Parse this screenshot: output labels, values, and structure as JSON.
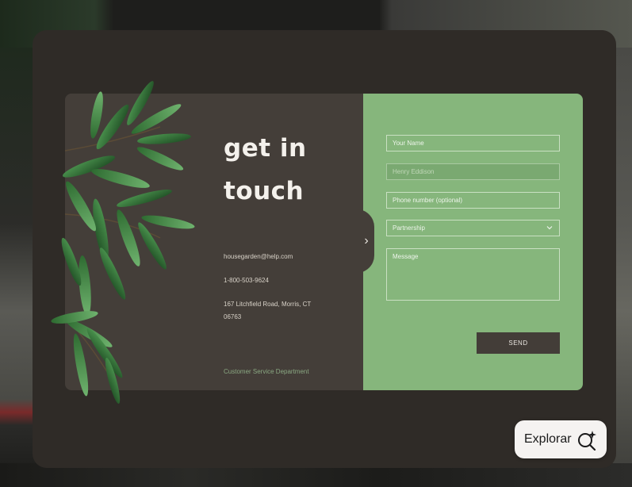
{
  "contact": {
    "title_line1": "get in",
    "title_line2": "touch",
    "email": "housegarden@help.com",
    "phone": "1-800-503-9624",
    "address": "167 Litchfield Road, Morris, CT 06763",
    "department": "Customer Service Department"
  },
  "form": {
    "name_placeholder": "Your Name",
    "filled_value": "Henry Eddison",
    "phone_placeholder": "Phone number (optional)",
    "select_value": "Partnership",
    "message_placeholder": "Message",
    "send_label": "SEND"
  },
  "explore": {
    "label": "Explorar",
    "icon": "search-sparkle-icon"
  },
  "colors": {
    "panel_dark": "#443e39",
    "panel_green": "#86b67c",
    "modal": "#2f2b27"
  }
}
